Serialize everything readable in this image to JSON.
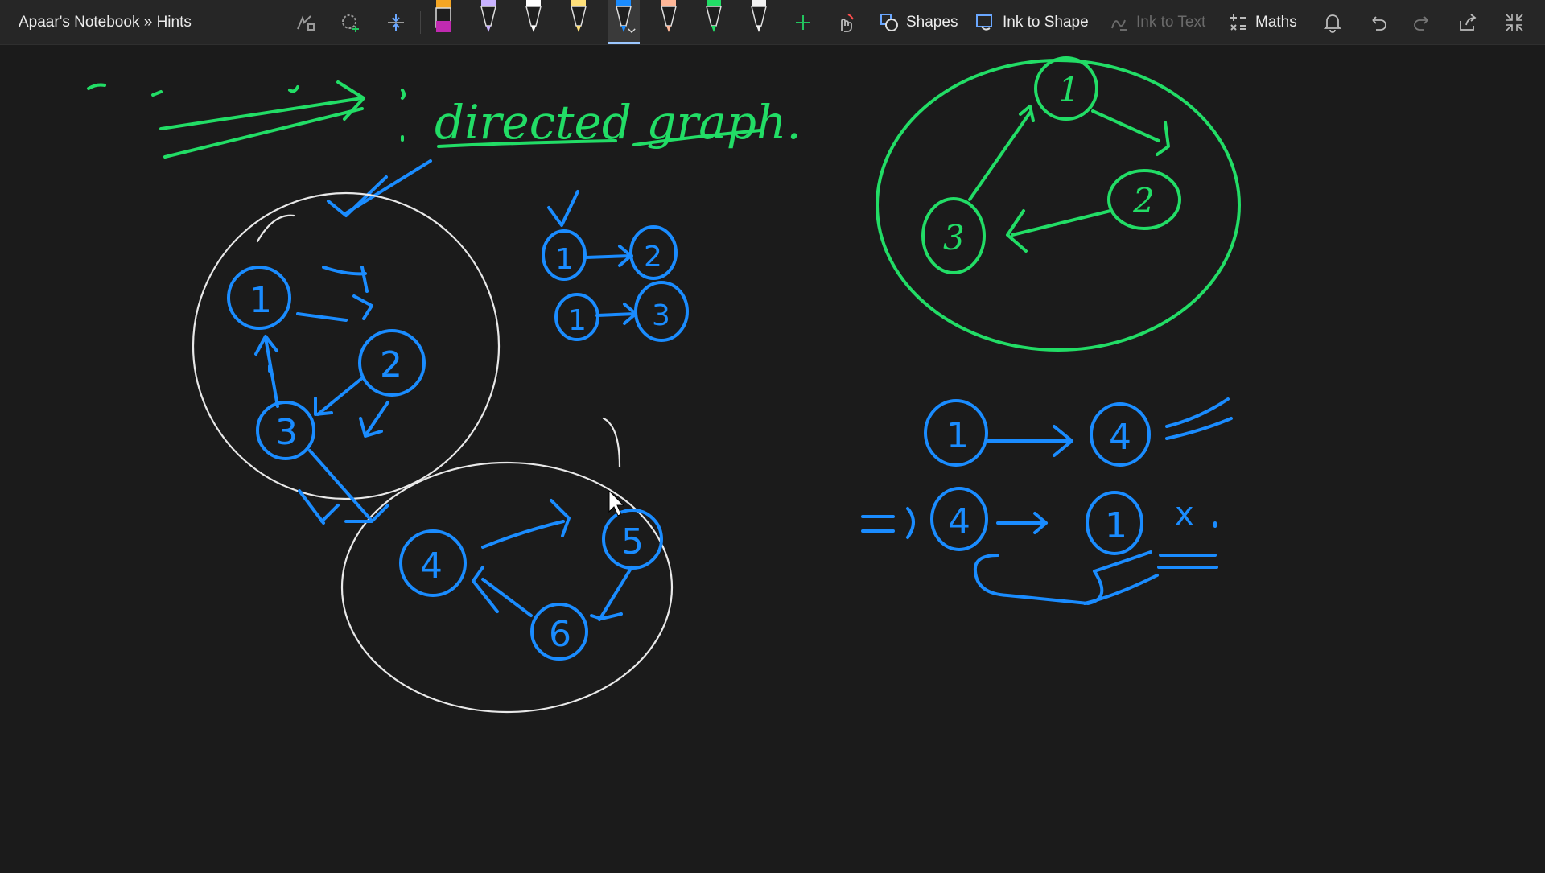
{
  "window": {
    "title": "Apaar's Notebook » Hints"
  },
  "toolbar": {
    "lasso_icon": "lasso-select-icon",
    "add_space_icon": "insert-space-icon",
    "pens": [
      {
        "name": "pen-highlighter-orange",
        "color": "#f5a623"
      },
      {
        "name": "pen-lavender",
        "color": "#c9b3ff"
      },
      {
        "name": "pen-white",
        "color": "#ffffff"
      },
      {
        "name": "pen-yellow",
        "color": "#ffe07a"
      },
      {
        "name": "pen-blue",
        "color": "#1a8cff",
        "selected": true
      },
      {
        "name": "pen-peach",
        "color": "#ffb899"
      },
      {
        "name": "pen-green",
        "color": "#22dd66"
      },
      {
        "name": "pen-white-2",
        "color": "#f2f2f2"
      }
    ],
    "shapes_label": "Shapes",
    "ink_to_shape_label": "Ink to Shape",
    "ink_to_text_label": "Ink to Text",
    "maths_label": "Maths"
  },
  "canvas": {
    "heading": "directed graph.",
    "nodes_big_left": [
      "1",
      "2",
      "3"
    ],
    "nodes_bottom": [
      "4",
      "5",
      "6"
    ],
    "nodes_small_pair1": [
      "1",
      "2"
    ],
    "nodes_small_pair2": [
      "1",
      "3"
    ],
    "nodes_green": [
      "1",
      "2",
      "3"
    ],
    "nodes_right_row1": [
      "1",
      "4"
    ],
    "nodes_right_row2": [
      "4",
      "1"
    ],
    "cross_mark": "x"
  }
}
